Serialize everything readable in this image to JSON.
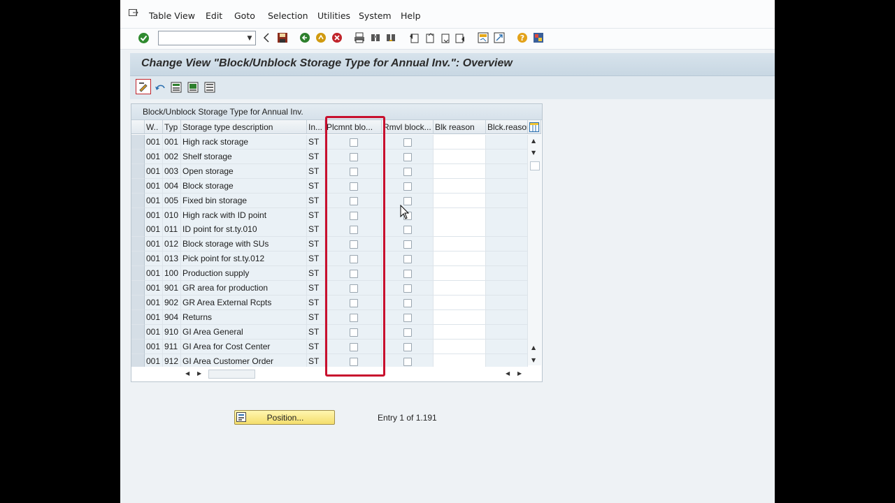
{
  "menu": {
    "items": [
      {
        "label": "Table View",
        "name": "menu-table-view"
      },
      {
        "label": "Edit",
        "name": "menu-edit"
      },
      {
        "label": "Goto",
        "name": "menu-goto"
      },
      {
        "label": "Selection",
        "name": "menu-selection"
      },
      {
        "label": "Utilities",
        "name": "menu-utilities"
      },
      {
        "label": "System",
        "name": "menu-system"
      },
      {
        "label": "Help",
        "name": "menu-help"
      }
    ]
  },
  "command_field": {
    "value": ""
  },
  "screen_title": "Change View \"Block/Unblock Storage Type for Annual Inv.\": Overview",
  "table": {
    "caption": "Block/Unblock Storage Type for Annual Inv.",
    "columns": [
      "W..",
      "Typ",
      "Storage type description",
      "In...",
      "Plcmnt blo...",
      "Rmvl block...",
      "Blk reason",
      "Blck.reason"
    ],
    "rows": [
      {
        "whse": "001",
        "typ": "001",
        "desc": "High rack storage",
        "inv": "ST",
        "plcmnt": false,
        "rmvl": false,
        "blk": "",
        "blck": ""
      },
      {
        "whse": "001",
        "typ": "002",
        "desc": "Shelf storage",
        "inv": "ST",
        "plcmnt": false,
        "rmvl": false,
        "blk": "",
        "blck": ""
      },
      {
        "whse": "001",
        "typ": "003",
        "desc": "Open storage",
        "inv": "ST",
        "plcmnt": false,
        "rmvl": false,
        "blk": "",
        "blck": ""
      },
      {
        "whse": "001",
        "typ": "004",
        "desc": "Block storage",
        "inv": "ST",
        "plcmnt": false,
        "rmvl": false,
        "blk": "",
        "blck": ""
      },
      {
        "whse": "001",
        "typ": "005",
        "desc": "Fixed bin storage",
        "inv": "ST",
        "plcmnt": false,
        "rmvl": false,
        "blk": "",
        "blck": ""
      },
      {
        "whse": "001",
        "typ": "010",
        "desc": "High rack with ID point",
        "inv": "ST",
        "plcmnt": false,
        "rmvl": false,
        "blk": "",
        "blck": ""
      },
      {
        "whse": "001",
        "typ": "011",
        "desc": "ID point for st.ty.010",
        "inv": "ST",
        "plcmnt": false,
        "rmvl": false,
        "blk": "",
        "blck": ""
      },
      {
        "whse": "001",
        "typ": "012",
        "desc": "Block storage with SUs",
        "inv": "ST",
        "plcmnt": false,
        "rmvl": false,
        "blk": "",
        "blck": ""
      },
      {
        "whse": "001",
        "typ": "013",
        "desc": "Pick point for st.ty.012",
        "inv": "ST",
        "plcmnt": false,
        "rmvl": false,
        "blk": "",
        "blck": ""
      },
      {
        "whse": "001",
        "typ": "100",
        "desc": "Production supply",
        "inv": "ST",
        "plcmnt": false,
        "rmvl": false,
        "blk": "",
        "blck": ""
      },
      {
        "whse": "001",
        "typ": "901",
        "desc": "GR area for production",
        "inv": "ST",
        "plcmnt": false,
        "rmvl": false,
        "blk": "",
        "blck": ""
      },
      {
        "whse": "001",
        "typ": "902",
        "desc": "GR Area External Rcpts",
        "inv": "ST",
        "plcmnt": false,
        "rmvl": false,
        "blk": "",
        "blck": ""
      },
      {
        "whse": "001",
        "typ": "904",
        "desc": "Returns",
        "inv": "ST",
        "plcmnt": false,
        "rmvl": false,
        "blk": "",
        "blck": ""
      },
      {
        "whse": "001",
        "typ": "910",
        "desc": "GI Area General",
        "inv": "ST",
        "plcmnt": false,
        "rmvl": false,
        "blk": "",
        "blck": ""
      },
      {
        "whse": "001",
        "typ": "911",
        "desc": "GI Area for Cost Center",
        "inv": "ST",
        "plcmnt": false,
        "rmvl": false,
        "blk": "",
        "blck": ""
      },
      {
        "whse": "001",
        "typ": "912",
        "desc": "GI Area Customer Order",
        "inv": "ST",
        "plcmnt": false,
        "rmvl": false,
        "blk": "",
        "blck": ""
      }
    ]
  },
  "position_button": {
    "label": "Position..."
  },
  "entry_info": "Entry 1 of 1.191",
  "colors": {
    "highlight_border": "#c8102e",
    "title_bg": "#d0dde8",
    "button_bg": "#f8e88a"
  }
}
